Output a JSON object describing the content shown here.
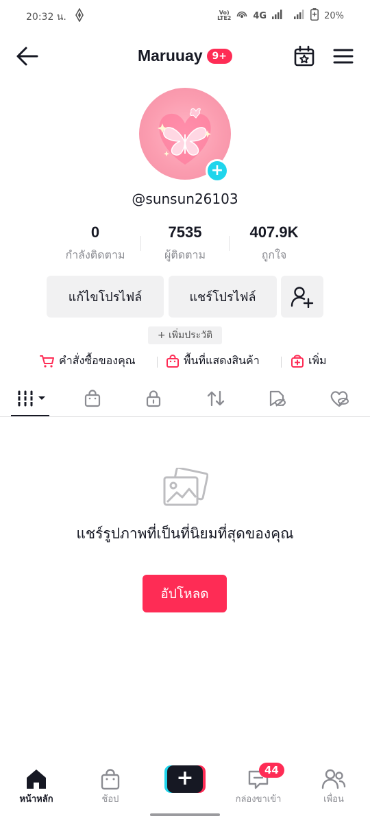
{
  "status_bar": {
    "time": "20:32 น.",
    "network": "4G",
    "volte_line1": "Vo)",
    "volte_line2": "LTE2",
    "battery": "20%"
  },
  "header": {
    "title": "Maruuay",
    "notification_badge": "9+"
  },
  "profile": {
    "username": "@sunsun26103",
    "avatar_add": "+"
  },
  "stats": [
    {
      "value": "0",
      "label": "กำลังติดตาม"
    },
    {
      "value": "7535",
      "label": "ผู้ติดตาม"
    },
    {
      "value": "407.9K",
      "label": "ถูกใจ"
    }
  ],
  "actions": {
    "edit_profile": "แก้ไขโปรไฟล์",
    "share_profile": "แชร์โปรไฟล์",
    "add_bio": "+ เพิ่มประวัติ"
  },
  "shop_links": {
    "orders": "คำสั่งซื้อของคุณ",
    "showcase": "พื้นที่แสดงสินค้า",
    "add": "เพิ่ม"
  },
  "empty_state": {
    "message": "แชร์รูปภาพที่เป็นที่นิยมที่สุดของคุณ",
    "upload_label": "อัปโหลด"
  },
  "bottom_nav": {
    "home": "หน้าหลัก",
    "shop": "ช้อป",
    "create": "+",
    "inbox": "กล่องขาเข้า",
    "inbox_badge": "44",
    "friends": "เพื่อน"
  },
  "colors": {
    "accent": "#fe2c55",
    "cyan": "#20d5ec",
    "text": "#161823",
    "muted": "#8a8b91"
  }
}
